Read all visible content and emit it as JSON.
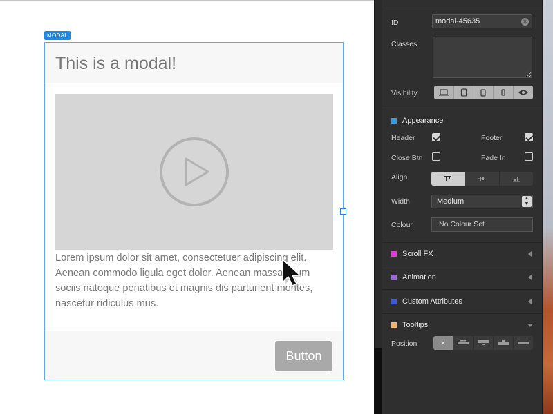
{
  "canvas": {
    "tag": "MODAL",
    "modal": {
      "title": "This is a modal!",
      "body_text": "Lorem ipsum dolor sit amet, consectetuer adipiscing elit. Aenean commodo ligula eget dolor. Aenean massa. Cum sociis natoque penatibus et magnis dis parturient montes, nascetur ridiculus mus.",
      "button_label": "Button",
      "video_icon": "play-icon"
    }
  },
  "panel": {
    "id_label": "ID",
    "id_value": "modal-45635",
    "classes_label": "Classes",
    "classes_value": "",
    "visibility_label": "Visibility",
    "visibility_icons": [
      "laptop-icon",
      "tablet-icon",
      "tablet-small-icon",
      "phone-icon",
      "eye-icon"
    ],
    "appearance": {
      "title": "Appearance",
      "color": "#3b9ad9",
      "header_label": "Header",
      "header_checked": true,
      "footer_label": "Footer",
      "footer_checked": true,
      "close_btn_label": "Close Btn",
      "close_btn_checked": false,
      "fade_in_label": "Fade In",
      "fade_in_checked": false,
      "align_label": "Align",
      "align_options": [
        "align-top-icon",
        "align-middle-icon",
        "align-bottom-icon"
      ],
      "align_selected": "align-top-icon",
      "width_label": "Width",
      "width_value": "Medium",
      "colour_label": "Colour",
      "colour_value": "No Colour Set"
    },
    "sections": [
      {
        "title": "Scroll FX",
        "color": "#e23ad7"
      },
      {
        "title": "Animation",
        "color": "#9b6ad6"
      },
      {
        "title": "Custom Attributes",
        "color": "#3c5bd6"
      }
    ],
    "tooltips": {
      "title": "Tooltips",
      "color": "#f0b86a",
      "position_label": "Position",
      "position_options": [
        "none-icon",
        "tooltip-top-icon",
        "tooltip-bottom-icon",
        "tooltip-left-icon",
        "tooltip-right-icon"
      ],
      "position_selected": "none-icon",
      "none_glyph": "×"
    }
  }
}
